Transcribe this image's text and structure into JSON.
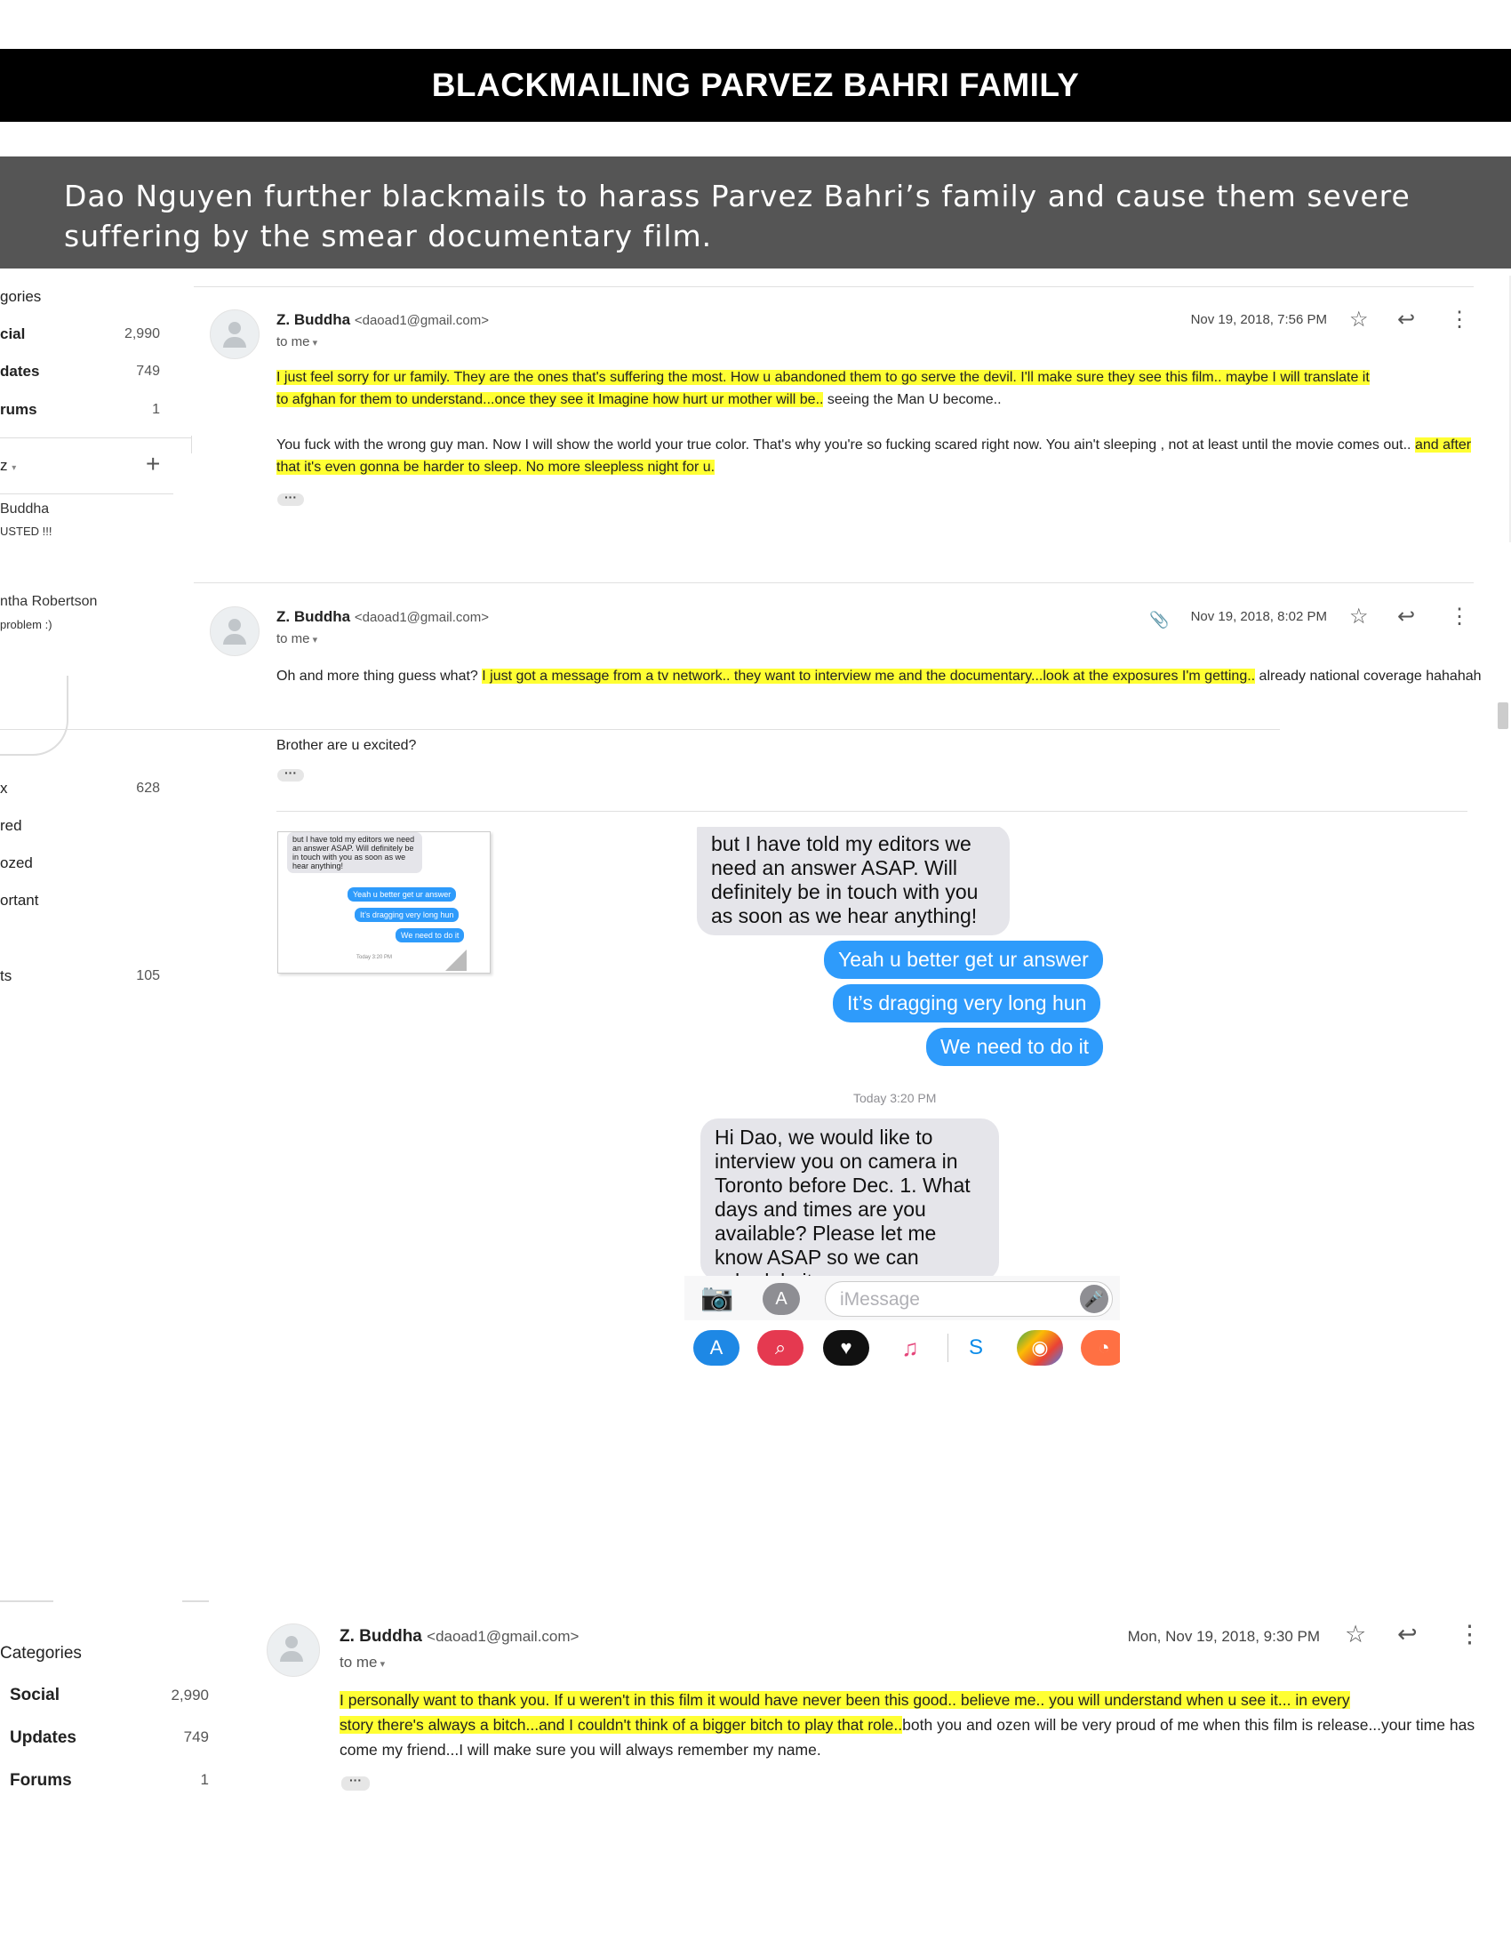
{
  "header": {
    "title": "BLACKMAILING PARVEZ BAHRI FAMILY",
    "subtitle": "Dao Nguyen further blackmails to harass Parvez Bahri’s family and cause them severe suffering by the smear documentary film."
  },
  "sidebar_top": {
    "categories_label": "gories",
    "items": [
      {
        "label": "cial",
        "count": "2,990"
      },
      {
        "label": "dates",
        "count": "749"
      },
      {
        "label": "rums",
        "count": "1"
      }
    ],
    "hangouts_label": "z",
    "contacts": [
      {
        "name": "Buddha",
        "snippet": "USTED !!!"
      },
      {
        "name": "ntha Robertson",
        "snippet": "problem :)"
      }
    ],
    "folders": [
      {
        "label": "x",
        "count": "628"
      },
      {
        "label": "red",
        "count": ""
      },
      {
        "label": "ozed",
        "count": ""
      },
      {
        "label": "ortant",
        "count": ""
      },
      {
        "label": "ts",
        "count": "105"
      }
    ]
  },
  "email1": {
    "sender_name": "Z. Buddha",
    "sender_email": "<daoad1@gmail.com>",
    "to": "to me",
    "date": "Nov 19, 2018, 7:56 PM",
    "p1_hl1": "I just feel sorry for ur family. They are the ones that's suffering the most. How u abandoned them to go serve the devil. I'll make sure they see this film.. maybe I will translate it",
    "p1_hl2": "to afghan for them to understand...once they see it Imagine how hurt ur mother will be..",
    "p1_rest": " seeing the Man U become..",
    "p2_plain": "You fuck with the wrong guy man. Now I will show the world your true color. That's why you're so fucking scared right now. You ain't sleeping , not at least until the movie comes out.. ",
    "p2_hl": "and after that it's even gonna be harder to sleep. No more sleepless night for u."
  },
  "email2": {
    "sender_name": "Z. Buddha",
    "sender_email": "<daoad1@gmail.com>",
    "to": "to me",
    "date": "Nov 19, 2018, 8:02 PM",
    "p1_plain": "Oh and more thing guess what? ",
    "p1_hl": "I just got a message from a tv network.. they want to interview me and the documentary...look at the exposures I'm getting..",
    "p1_rest": " already national coverage hahahah",
    "p2": "Brother are u excited?"
  },
  "imessage": {
    "in1": "but I have told my editors we need an answer ASAP. Will definitely be in touch with you as soon as we hear anything!",
    "out1": "Yeah u better get ur answer",
    "out2": "It’s dragging very long hun",
    "out3": "We need to do it",
    "timestamp": "Today 3:20 PM",
    "in2": "Hi Dao, we would like to interview you on camera in Toronto before Dec. 1. What days and times are you available? Please let me know ASAP so we can schedule it.",
    "input_placeholder": "iMessage",
    "thumb_timestamp": "Today 3:20 PM"
  },
  "sidebar_bottom": {
    "categories_label": "Categories",
    "items": [
      {
        "label": "Social",
        "count": "2,990"
      },
      {
        "label": "Updates",
        "count": "749"
      },
      {
        "label": "Forums",
        "count": "1"
      }
    ]
  },
  "email3": {
    "sender_name": "Z. Buddha",
    "sender_email": "<daoad1@gmail.com>",
    "to": "to me",
    "date": "Mon, Nov 19, 2018, 9:30 PM",
    "hl1": "I personally want to thank you. If u weren't in this film it would have never been this good.. believe me.. you will understand when u see it... in every",
    "hl2": "story there's always a bitch...and I couldn't think of a bigger bitch to play that role..",
    "rest": "both you and ozen will be very proud of me when this film is release...your time has come my friend...I will make sure you will always remember my name."
  },
  "colors": {
    "highlight": "#ffff33",
    "imessage_blue": "#2e9bfb",
    "banner": "#000000",
    "subtitle_bg": "#555555"
  }
}
